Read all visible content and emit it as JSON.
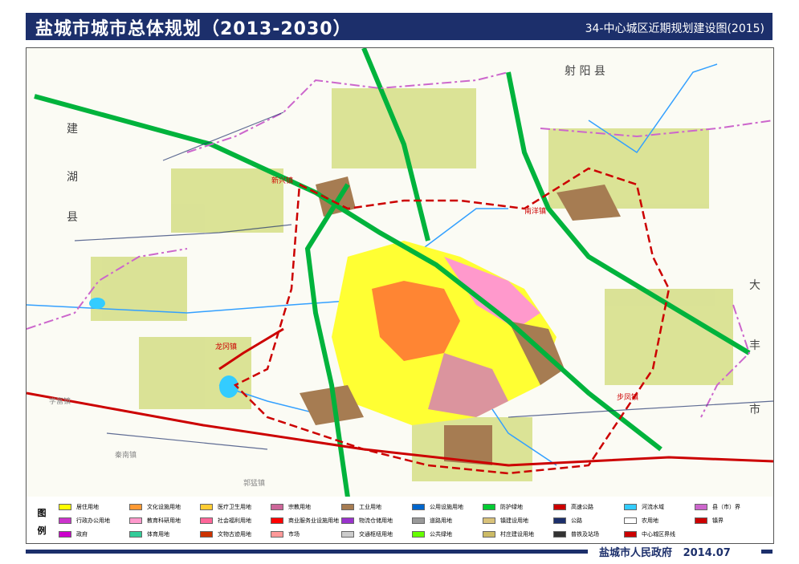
{
  "header": {
    "title": "盐城市城市总体规划（2013-2030）",
    "subtitle": "34-中心城区近期规划建设图(2015)"
  },
  "map": {
    "county_labels": [
      {
        "text": "射 阳 县"
      },
      {
        "text": "建"
      },
      {
        "text": "湖"
      },
      {
        "text": "县"
      },
      {
        "text": "大"
      },
      {
        "text": "丰"
      },
      {
        "text": "市"
      }
    ],
    "town_labels": [
      {
        "text": "新兴镇"
      },
      {
        "text": "南洋镇"
      },
      {
        "text": "龙冈镇"
      },
      {
        "text": "步凤镇"
      }
    ],
    "gray_towns": [
      {
        "text": "学富镇"
      },
      {
        "text": "秦南镇"
      },
      {
        "text": "郭猛镇"
      }
    ]
  },
  "legend": {
    "title": "图 例",
    "items": [
      {
        "label": "居住用地",
        "color": "#ffff00"
      },
      {
        "label": "文化设施用地",
        "color": "#ff9933"
      },
      {
        "label": "医疗卫生用地",
        "color": "#ffcc33"
      },
      {
        "label": "宗教用地",
        "color": "#cc6699"
      },
      {
        "label": "工业用地",
        "color": "#a67c52"
      },
      {
        "label": "公用设施用地",
        "color": "#0066cc"
      },
      {
        "label": "防护绿地",
        "color": "#00cc33"
      },
      {
        "label": "高速公路",
        "color": "#cc0000"
      },
      {
        "label": "河流水域",
        "color": "#33ccff"
      },
      {
        "label": "县（市）界",
        "color": "#cc66cc"
      },
      {
        "label": "行政办公用地",
        "color": "#cc33cc"
      },
      {
        "label": "教育科研用地",
        "color": "#ff99cc"
      },
      {
        "label": "社会福利用地",
        "color": "#ff6699"
      },
      {
        "label": "商业服务业设施用地",
        "color": "#ff0000"
      },
      {
        "label": "物流仓储用地",
        "color": "#9933cc"
      },
      {
        "label": "道路用地",
        "color": "#999999"
      },
      {
        "label": "镇建设用地",
        "color": "#d9c27a"
      },
      {
        "label": "公路",
        "color": "#1c2f6b"
      },
      {
        "label": "农用地",
        "color": "#ffffff"
      },
      {
        "label": "镇界",
        "color": "#cc0000"
      },
      {
        "label": "政府",
        "color": "#cc00cc"
      },
      {
        "label": "体育用地",
        "color": "#33cc99"
      },
      {
        "label": "文物古迹用地",
        "color": "#cc3300"
      },
      {
        "label": "市场",
        "color": "#ff9999"
      },
      {
        "label": "交通枢纽用地",
        "color": "#cccccc"
      },
      {
        "label": "公共绿地",
        "color": "#66ff00"
      },
      {
        "label": "村庄建设用地",
        "color": "#ccbb66"
      },
      {
        "label": "普铁及站场",
        "color": "#333333"
      },
      {
        "label": "中心城区界线",
        "color": "#cc0000"
      }
    ]
  },
  "footer": {
    "org": "盐城市人民政府",
    "date": "2014.07"
  }
}
